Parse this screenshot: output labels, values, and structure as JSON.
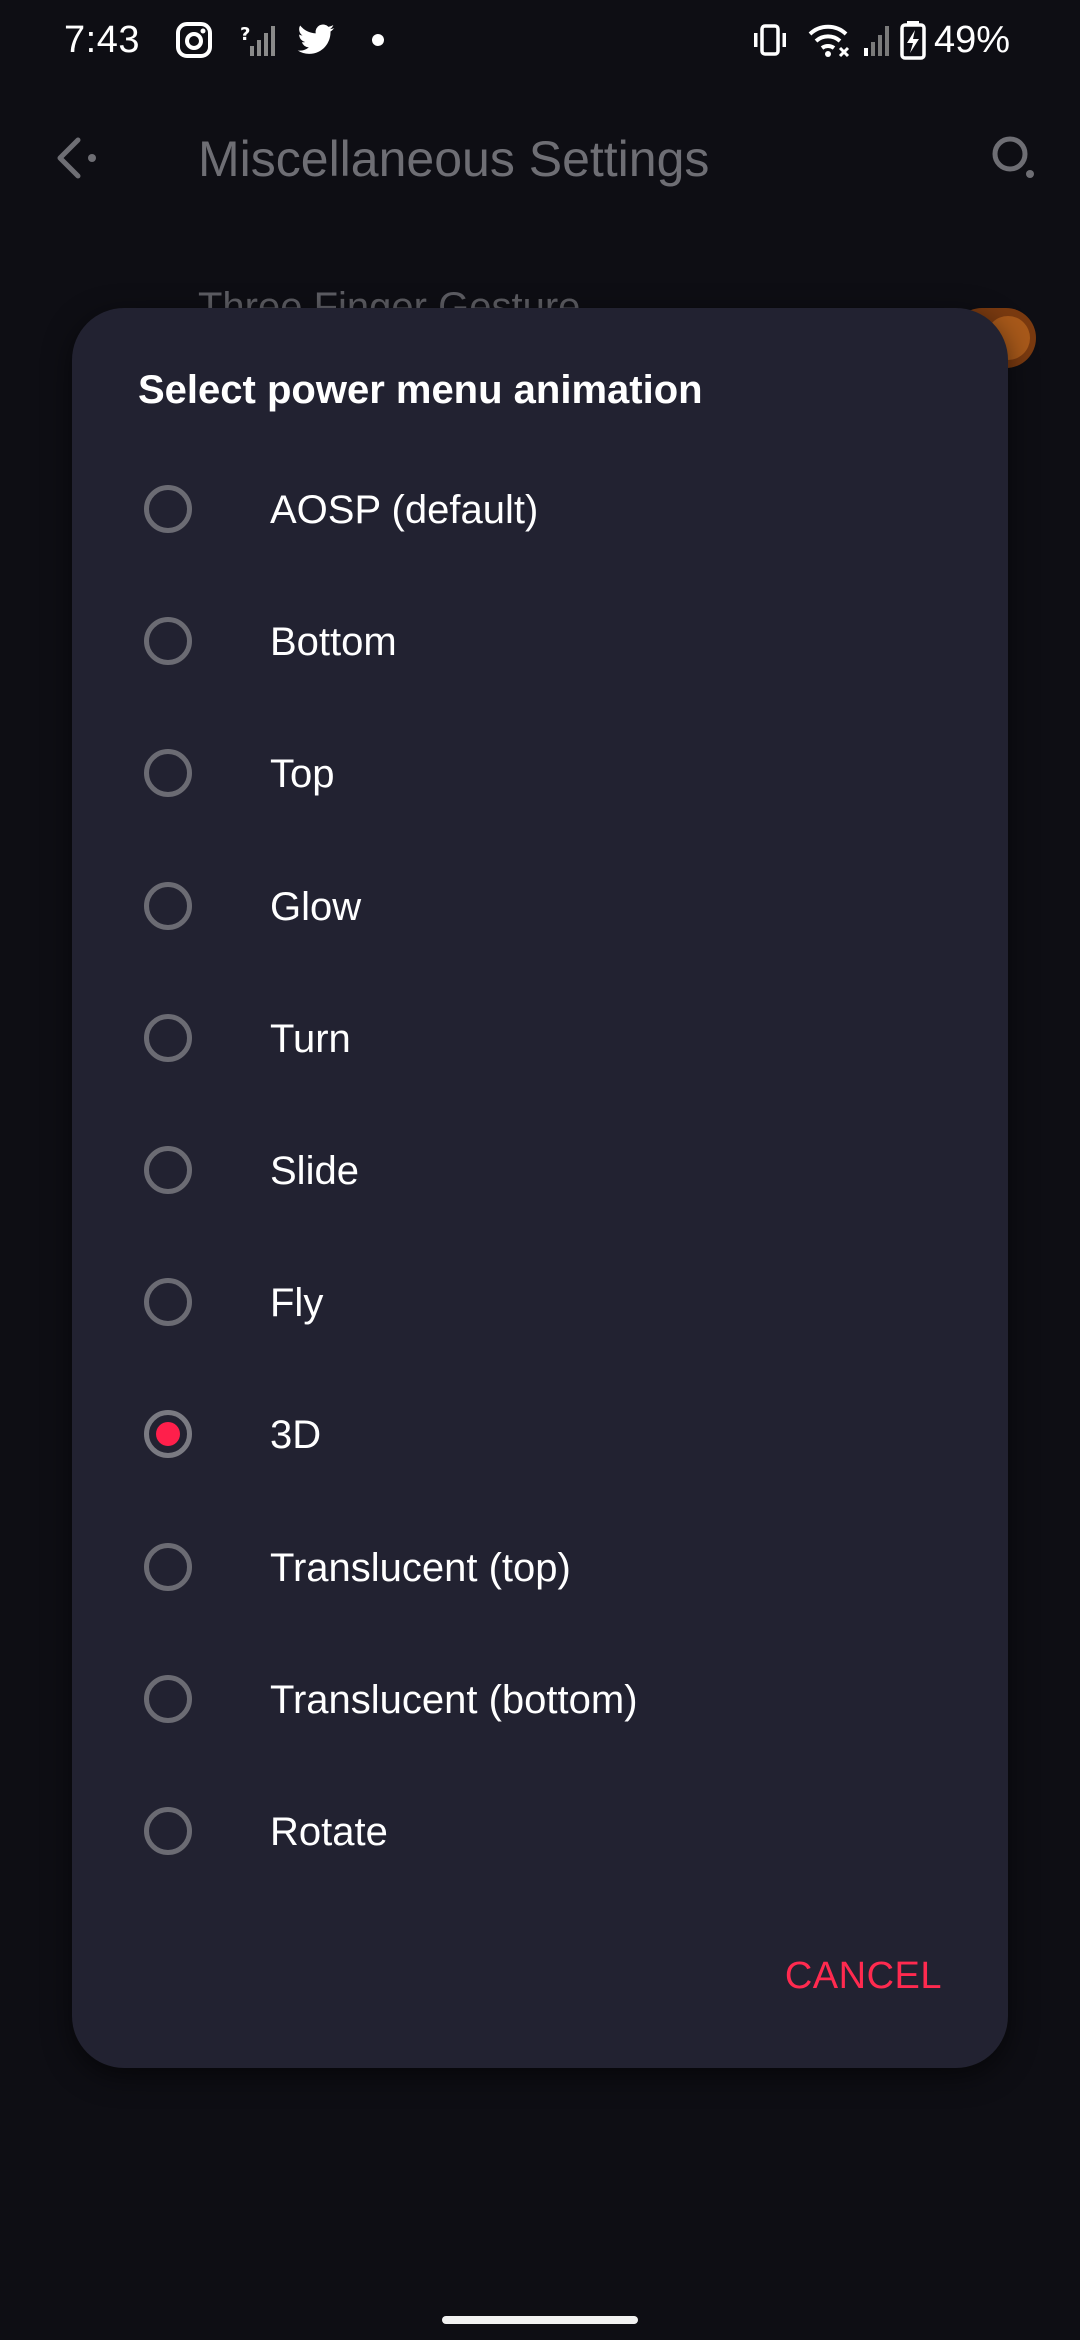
{
  "status_bar": {
    "time": "7:43",
    "battery": "49%",
    "icons": [
      "camera-notification-icon",
      "no-signal-icon",
      "twitter-icon",
      "notification-dot-icon",
      "vibrate-icon",
      "wifi-icon",
      "cell-signal-icon",
      "battery-charging-icon"
    ]
  },
  "app_bar": {
    "title": "Miscellaneous Settings",
    "back_icon": "back-arrow-icon",
    "search_icon": "search-icon"
  },
  "background": {
    "pref_title": "Three Finger Gesture",
    "toggle_color": "#a8591a"
  },
  "dialog": {
    "title": "Select power menu animation",
    "options": [
      {
        "label": "AOSP (default)",
        "selected": false
      },
      {
        "label": "Bottom",
        "selected": false
      },
      {
        "label": "Top",
        "selected": false
      },
      {
        "label": "Glow",
        "selected": false
      },
      {
        "label": "Turn",
        "selected": false
      },
      {
        "label": "Slide",
        "selected": false
      },
      {
        "label": "Fly",
        "selected": false
      },
      {
        "label": "3D",
        "selected": true
      },
      {
        "label": "Translucent (top)",
        "selected": false
      },
      {
        "label": "Translucent (bottom)",
        "selected": false
      },
      {
        "label": "Rotate",
        "selected": false
      }
    ],
    "cancel_label": "CANCEL"
  },
  "colors": {
    "accent": "#ff1f4b",
    "dialog_background": "#222231",
    "screen_background": "#0e0e14"
  }
}
